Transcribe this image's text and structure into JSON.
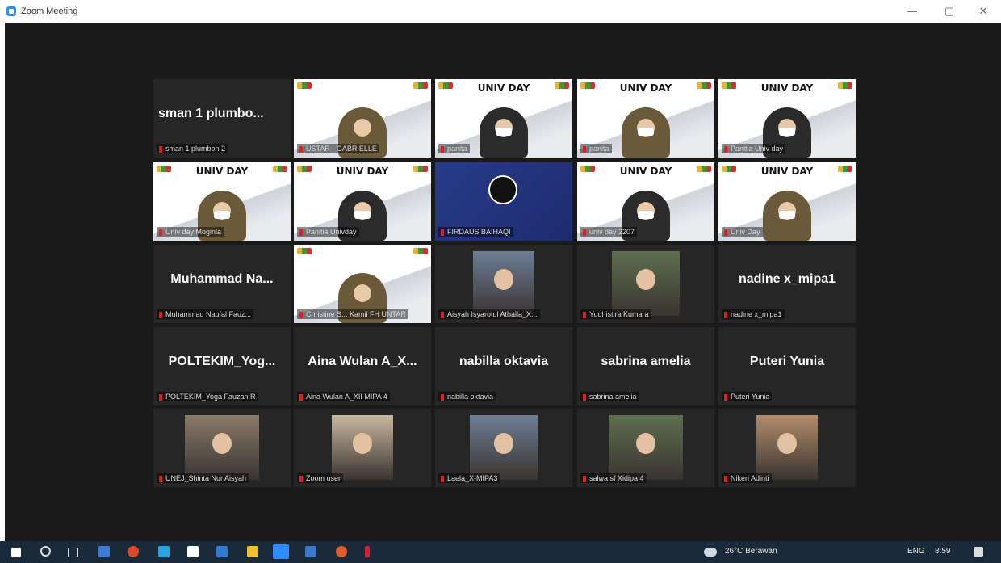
{
  "window": {
    "title": "Zoom Meeting",
    "minimize": "—",
    "restore": "▢",
    "close": "✕"
  },
  "tiles": [
    {
      "big": "sman 1 plumbo...",
      "label": "sman 1 plumbon 2"
    },
    {
      "label": "USTAR - GABRIELLE",
      "poster": "",
      "active": true
    },
    {
      "label": "panita",
      "poster": "UNIV DAY"
    },
    {
      "label": "panita",
      "poster": "UNIV DAY"
    },
    {
      "label": "Panitia Univ day",
      "poster": "UNIV DAY"
    },
    {
      "label": "Univ day Moginla",
      "poster": "UNIV DAY"
    },
    {
      "label": "Panitia Univday",
      "poster": "UNIV DAY"
    },
    {
      "label": "FIRDAUS BAIHAQI",
      "obs": true
    },
    {
      "label": "univ day 2207",
      "poster": "UNIV DAY"
    },
    {
      "label": "Univ Day",
      "poster": "UNIV DAY"
    },
    {
      "big": "Muhammad  Na...",
      "label": "Muhammad Naufal Fauz..."
    },
    {
      "label": "Christine S... Kamil FH UNTAR",
      "poster": ""
    },
    {
      "label": "Aisyah Isyarotul Athalla_X...",
      "photo": true
    },
    {
      "label": "Yudhistira Kumara",
      "photo": true
    },
    {
      "big": "nadine x_mipa1",
      "label": "nadine x_mipa1"
    },
    {
      "big": "POLTEKIM_Yog...",
      "label": "POLTEKIM_Yoga Fauzan R"
    },
    {
      "big": "Aina Wulan A_X...",
      "label": "Aina Wulan A_XII MIPA 4"
    },
    {
      "big": "nabilla oktavia",
      "label": "nabilla oktavia"
    },
    {
      "big": "sabrina amelia",
      "label": "sabrina amelia"
    },
    {
      "big": "Puteri Yunia",
      "label": "Puteri Yunia"
    },
    {
      "label": "UNEJ_Shinta Nur Aisyah",
      "photo": true
    },
    {
      "label": "Zoom user",
      "photo": true
    },
    {
      "label": "Laela_X-MIPA3",
      "photo": true
    },
    {
      "label": "salwa sf Xidipa 4",
      "photo": true
    },
    {
      "label": "Nikeri Adinti",
      "photo": true
    }
  ],
  "taskbar": {
    "weather": "26°C  Berawan",
    "lang": "ENG",
    "time": "8:59"
  }
}
